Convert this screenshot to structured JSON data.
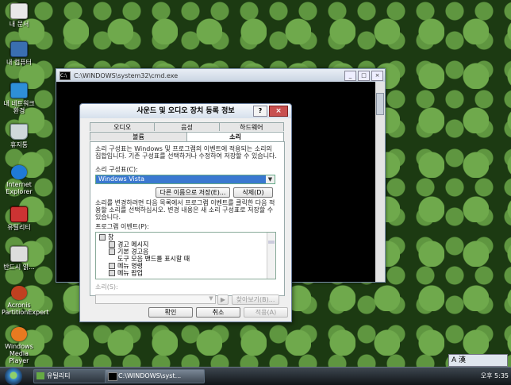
{
  "desktop": {
    "icons": [
      {
        "label": "내 문서",
        "icon": "documents-icon"
      },
      {
        "label": "내 컴퓨터",
        "icon": "computer-icon"
      },
      {
        "label": "내 네트워크 환경",
        "icon": "network-icon"
      },
      {
        "label": "휴지통",
        "icon": "recycle-bin-icon"
      },
      {
        "label": "Internet Explorer",
        "icon": "internet-explorer-icon"
      },
      {
        "label": "유틸리티",
        "icon": "utility-folder-icon"
      },
      {
        "label": "반드시 읽...",
        "icon": "readme-icon"
      },
      {
        "label": "Acronis PartitionExpert",
        "icon": "acronis-icon"
      },
      {
        "label": "Windows Media Player",
        "icon": "media-player-icon"
      }
    ]
  },
  "cmd_window": {
    "title": "C:\\WINDOWS\\system32\\cmd.exe",
    "minimize": "_",
    "maximize": "□",
    "close": "×"
  },
  "dialog": {
    "title": "사운드 및 오디오 장치 등록 정보",
    "help_button": "?",
    "close_button": "×",
    "tabs_row1": [
      "오디오",
      "음성",
      "하드웨어"
    ],
    "tabs_row2": [
      "볼륨",
      "소리"
    ],
    "active_tab": "소리",
    "intro_text": "소리 구성표는 Windows 및 프로그램의 이벤트에 적용되는 소리의 집합입니다. 기존 구성표를 선택하거나 수정하여 저장할 수 있습니다.",
    "scheme_label": "소리 구성표(C):",
    "scheme_value": "Windows Vista",
    "save_as_button": "다른 이름으로 저장(E)...",
    "delete_button": "삭제(D)",
    "change_text": "소리를 변경하려면 다음 목록에서 프로그램 이벤트를 클릭한 다음 적용할 소리를 선택하십시오. 변경 내용은 새 소리 구성표로 저장할 수 있습니다.",
    "events_label": "프로그램 이벤트(P):",
    "events": [
      {
        "label": "창",
        "level": 0
      },
      {
        "label": "경고 메시지",
        "level": 1
      },
      {
        "label": "기본 경고음",
        "level": 1
      },
      {
        "label": "도구 모음 밴드를 표시할 때",
        "level": 1
      },
      {
        "label": "메뉴 명령",
        "level": 1
      },
      {
        "label": "메뉴 팝업",
        "level": 1
      }
    ],
    "sound_label": "소리(S):",
    "play_button": "▶",
    "browse_button": "찾아보기(B)...",
    "ok_button": "확인",
    "cancel_button": "취소",
    "apply_button": "적용(A)"
  },
  "taskbar": {
    "tasks": [
      {
        "label": "유틸리티"
      },
      {
        "label": "C:\\WINDOWS\\syst..."
      }
    ],
    "ime": "A 漢",
    "clock": "오후 5:35"
  },
  "colors": {
    "selection": "#3a78d0",
    "close_button": "#c85050",
    "taskbar": "#1f262c"
  }
}
